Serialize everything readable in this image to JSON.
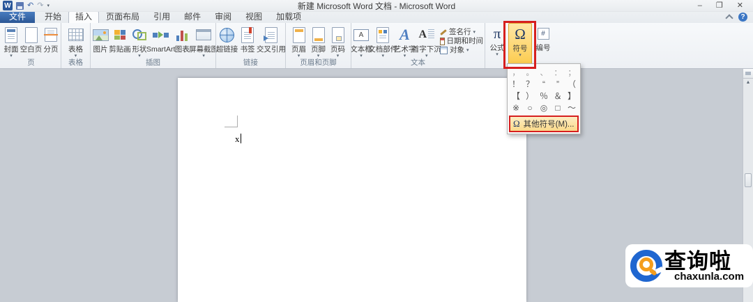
{
  "window": {
    "title": "新建 Microsoft Word 文档 - Microsoft Word",
    "controls": {
      "minimize": "–",
      "restore": "❐",
      "close": "✕"
    },
    "help": "?"
  },
  "quick_access": {
    "app": "W",
    "undo": "↶",
    "redo": "↷",
    "customize": "▾"
  },
  "tabs": [
    {
      "label": "文件"
    },
    {
      "label": "开始"
    },
    {
      "label": "插入"
    },
    {
      "label": "页面布局"
    },
    {
      "label": "引用"
    },
    {
      "label": "邮件"
    },
    {
      "label": "审阅"
    },
    {
      "label": "视图"
    },
    {
      "label": "加载项"
    }
  ],
  "ribbon": {
    "groups": [
      {
        "label": "页",
        "buttons": [
          {
            "label": "封面",
            "arrow": "▾"
          },
          {
            "label": "空白页"
          },
          {
            "label": "分页"
          }
        ]
      },
      {
        "label": "表格",
        "buttons": [
          {
            "label": "表格",
            "arrow": "▾"
          }
        ]
      },
      {
        "label": "插图",
        "buttons": [
          {
            "label": "图片"
          },
          {
            "label": "剪贴画"
          },
          {
            "label": "形状",
            "arrow": "▾"
          },
          {
            "label": "SmartArt"
          },
          {
            "label": "图表"
          },
          {
            "label": "屏幕截图",
            "arrow": "▾"
          }
        ]
      },
      {
        "label": "链接",
        "buttons": [
          {
            "label": "超链接"
          },
          {
            "label": "书签"
          },
          {
            "label": "交叉引用"
          }
        ]
      },
      {
        "label": "页眉和页脚",
        "buttons": [
          {
            "label": "页眉",
            "arrow": "▾"
          },
          {
            "label": "页脚",
            "arrow": "▾"
          },
          {
            "label": "页码",
            "arrow": "▾"
          }
        ]
      },
      {
        "label": "文本",
        "buttons": [
          {
            "label": "文本框",
            "arrow": "▾"
          },
          {
            "label": "文档部件",
            "arrow": "▾"
          },
          {
            "label": "艺术字",
            "arrow": "▾"
          },
          {
            "label": "首字下沉",
            "arrow": "▾"
          }
        ],
        "small_buttons": [
          {
            "label": "签名行",
            "arrow": "▾"
          },
          {
            "label": "日期和时间"
          },
          {
            "label": "对象",
            "arrow": "▾"
          }
        ]
      },
      {
        "label": "",
        "buttons": [
          {
            "label": "公式",
            "arrow": "▾"
          },
          {
            "label": "符号",
            "arrow": "▾"
          },
          {
            "label": "编号"
          }
        ]
      }
    ]
  },
  "icons": {
    "equation": "π",
    "symbol": "Ω",
    "numbering": "#",
    "letter_a": "A",
    "up_arrow": "▲"
  },
  "symbol_menu": {
    "rows": [
      [
        "，",
        "。",
        "、",
        "：",
        "；"
      ],
      [
        "！",
        "？",
        "“",
        "”",
        "（"
      ],
      [
        "【",
        "）",
        "％",
        "＆",
        "】"
      ],
      [
        "※",
        "○",
        "◎",
        "□",
        "～"
      ]
    ],
    "more_label": "其他符号(M)..."
  },
  "document": {
    "typed_text": "x"
  },
  "watermark": {
    "brand": "查询啦",
    "site": "chaxunla.com"
  },
  "colors": {
    "highlight_red": "#d61f1f",
    "button_orange": "#fcca49",
    "file_tab_blue": "#2c5795"
  }
}
